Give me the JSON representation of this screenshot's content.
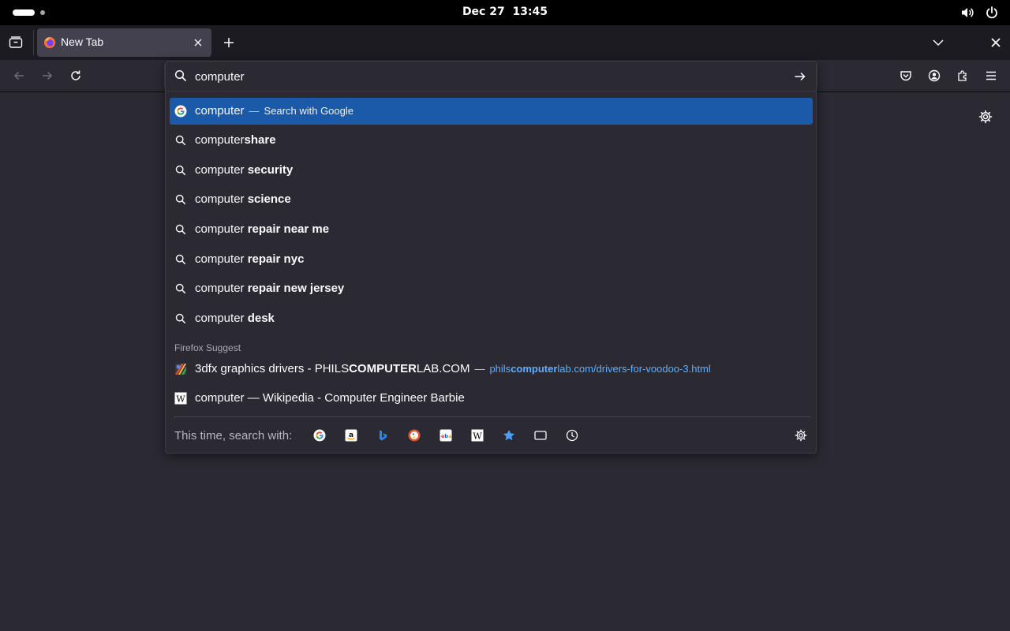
{
  "system_bar": {
    "date": "Dec 27",
    "time": "13:45",
    "icons": [
      "activities-indicator",
      "volume-icon",
      "power-icon"
    ]
  },
  "tabs": [
    {
      "title": "New Tab",
      "favicon": "firefox-logo",
      "active": true
    }
  ],
  "tabstrip_icons": [
    "tab-list-icon",
    "new-tab-plus-icon",
    "tab-overflow-chevron-icon",
    "window-close-icon"
  ],
  "toolbar_icons": [
    "back-icon",
    "forward-icon",
    "reload-icon",
    "pocket-icon",
    "account-icon",
    "extensions-icon",
    "menu-icon"
  ],
  "urlbar": {
    "value": "computer",
    "go_icon": "arrow-right-icon"
  },
  "results": [
    {
      "icon": "google-icon",
      "prefix": "computer",
      "bold": "",
      "separator": "—",
      "action": "Search with Google",
      "selected": true
    },
    {
      "icon": "search-icon",
      "prefix": "computer",
      "bold": "share"
    },
    {
      "icon": "search-icon",
      "prefix": "computer ",
      "bold": "security"
    },
    {
      "icon": "search-icon",
      "prefix": "computer ",
      "bold": "science"
    },
    {
      "icon": "search-icon",
      "prefix": "computer ",
      "bold": "repair near me"
    },
    {
      "icon": "search-icon",
      "prefix": "computer ",
      "bold": "repair nyc"
    },
    {
      "icon": "search-icon",
      "prefix": "computer ",
      "bold": "repair new jersey"
    },
    {
      "icon": "search-icon",
      "prefix": "computer ",
      "bold": "desk"
    }
  ],
  "firefox_suggest": {
    "label": "Firefox Suggest",
    "items": [
      {
        "icon": "philscomputerlab-favicon",
        "title_pre": "3dfx graphics drivers - PHILS",
        "title_bold": "COMPUTER",
        "title_post": "LAB.COM",
        "separator": "—",
        "url_pre": "phils",
        "url_bold": "computer",
        "url_post": "lab.com/drivers-for-voodoo-3.html"
      },
      {
        "icon": "wikipedia-icon",
        "title": "computer — Wikipedia - Computer Engineer Barbie"
      }
    ]
  },
  "one_off": {
    "label": "This time, search with:",
    "engines": [
      "google-icon",
      "amazon-icon",
      "bing-icon",
      "duckduckgo-icon",
      "ebay-icon",
      "wikipedia-icon",
      "bookmarks-star-icon",
      "tabs-icon",
      "history-clock-icon"
    ],
    "settings_icon": "gear-icon"
  },
  "colors": {
    "top_bar": "#000000",
    "tab_strip": "#1c1b22",
    "toolbar": "#2b2a33",
    "selected_row": "#1a5aa8",
    "url_link": "#5eaeff"
  }
}
